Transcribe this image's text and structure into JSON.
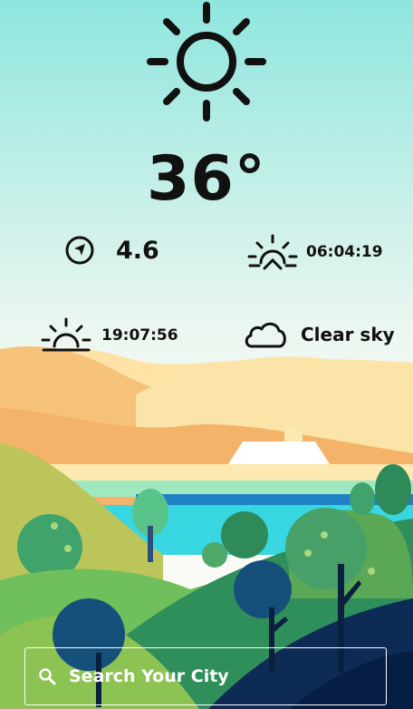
{
  "weather": {
    "temperature": "36°",
    "wind_speed": "4.6",
    "sunrise": "06:04:19",
    "sunset": "19:07:56",
    "condition": "Clear sky"
  },
  "icons": {
    "main": "sun-icon",
    "wind": "compass-icon",
    "sunrise": "sunrise-icon",
    "sunset": "sunset-icon",
    "condition": "cloud-icon",
    "search": "search-icon"
  },
  "search": {
    "placeholder": "Search Your City"
  },
  "colors": {
    "sky_top": "#8fe6df",
    "sky_bottom": "#f6f8f4",
    "text": "#111111"
  }
}
